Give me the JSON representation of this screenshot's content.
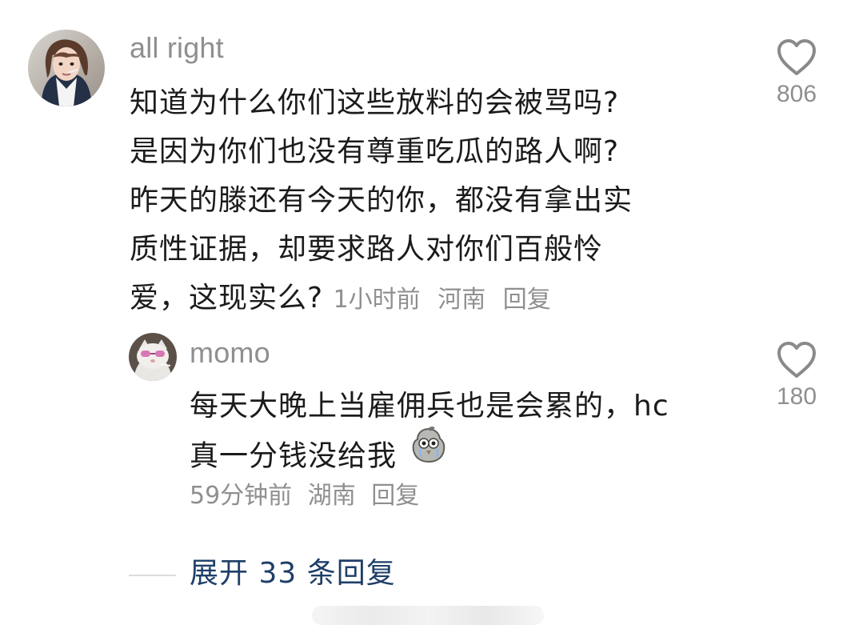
{
  "comment": {
    "user": "all right",
    "text_lines": [
      "知道为什么你们这些放料的会被骂吗?",
      "是因为你们也没有尊重吃瓜的路人啊?",
      "昨天的滕还有今天的你，都没有拿出实",
      "质性证据，却要求路人对你们百般怜",
      "爱，这现实么?"
    ],
    "time": "1小时前",
    "location": "河南",
    "reply_label": "回复",
    "likes": "806"
  },
  "reply": {
    "user": "momo",
    "text_lines": [
      "每天大晚上当雇佣兵也是会累的，hc",
      "真一分钱没给我"
    ],
    "emoji_icon": "crying-pigeon-emoji",
    "time": "59分钟前",
    "location": "湖南",
    "reply_label": "回复",
    "likes": "180"
  },
  "expand": {
    "label": "展开 33 条回复"
  },
  "colors": {
    "primary_text": "#1b1b1b",
    "secondary_text": "#8f8f8f",
    "expand_link": "#1f3f68"
  }
}
